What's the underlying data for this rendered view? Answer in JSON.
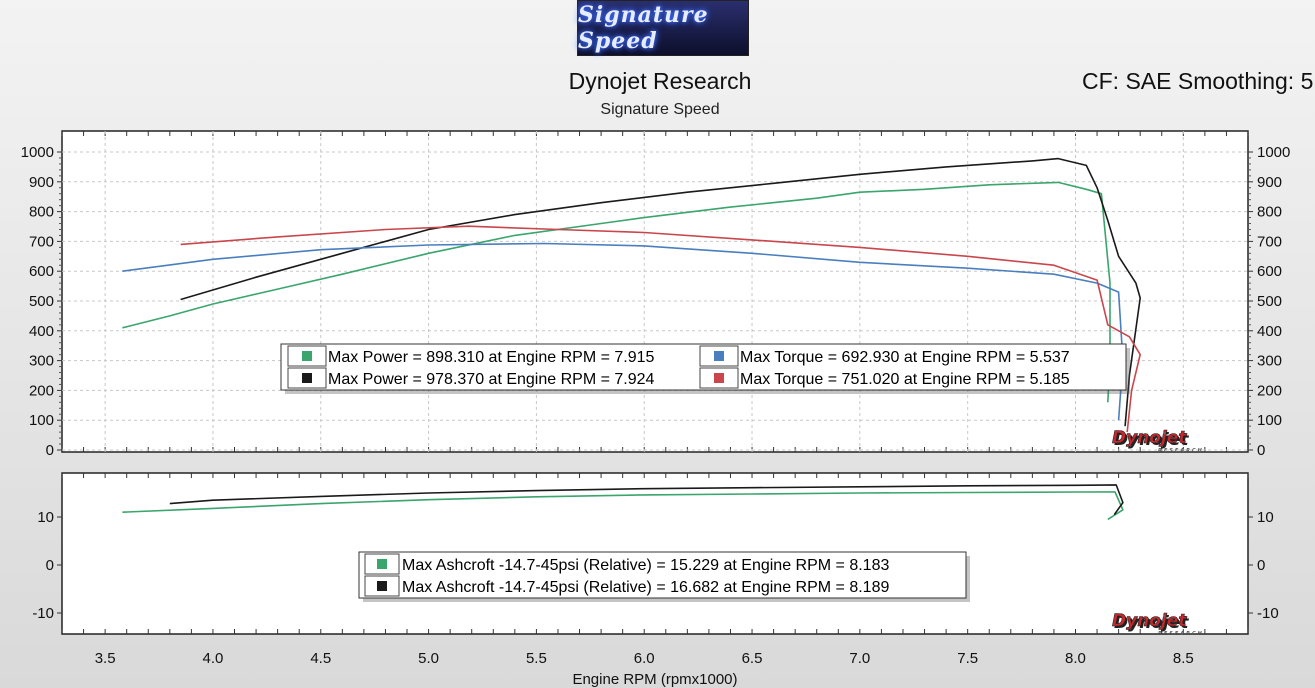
{
  "header": {
    "logo_text": "Signature Speed",
    "title": "Dynojet Research",
    "subtitle": "Signature Speed",
    "cf_text": "CF: SAE Smoothing: 5"
  },
  "brand": {
    "mark": "Dynojet",
    "sub": "RESEARCH"
  },
  "colors": {
    "green": "#3aa56d",
    "black": "#1a1a1a",
    "blue": "#4a7fbf",
    "red": "#c9474c",
    "grid": "#c8c8c8",
    "plot_bg": "#ffffff"
  },
  "chart_data": [
    {
      "type": "line",
      "xlabel": "Engine RPM (rpmx1000)",
      "xlim": [
        3.3,
        8.8
      ],
      "ylim": [
        0,
        1000
      ],
      "y_ticks": [
        0,
        100,
        200,
        300,
        400,
        500,
        600,
        700,
        800,
        900,
        1000
      ],
      "x_ticks": [
        3.5,
        4.0,
        4.5,
        5.0,
        5.5,
        6.0,
        6.5,
        7.0,
        7.5,
        8.0,
        8.5
      ],
      "grid": true,
      "series": [
        {
          "color_key": "green",
          "x": [
            3.58,
            3.8,
            4.0,
            4.3,
            4.6,
            5.0,
            5.4,
            5.8,
            6.0,
            6.4,
            6.8,
            7.0,
            7.3,
            7.6,
            7.92,
            8.05,
            8.12,
            8.16,
            8.16,
            8.15
          ],
          "y": [
            410,
            450,
            490,
            540,
            590,
            660,
            720,
            760,
            780,
            815,
            845,
            865,
            875,
            890,
            898,
            875,
            860,
            560,
            300,
            160
          ]
        },
        {
          "color_key": "black",
          "x": [
            3.85,
            4.2,
            4.6,
            5.0,
            5.4,
            5.8,
            6.2,
            6.6,
            7.0,
            7.4,
            7.8,
            7.92,
            8.05,
            8.1,
            8.15,
            8.2,
            8.28,
            8.3,
            8.25,
            8.23
          ],
          "y": [
            505,
            580,
            660,
            740,
            790,
            830,
            865,
            895,
            925,
            950,
            970,
            978,
            955,
            880,
            770,
            650,
            560,
            510,
            250,
            80
          ]
        },
        {
          "color_key": "blue",
          "x": [
            3.58,
            4.0,
            4.5,
            5.0,
            5.537,
            6.0,
            6.5,
            7.0,
            7.5,
            7.9,
            8.1,
            8.2,
            8.22,
            8.2
          ],
          "y": [
            600,
            640,
            672,
            688,
            693,
            685,
            660,
            630,
            610,
            590,
            560,
            530,
            300,
            100
          ]
        },
        {
          "color_key": "red",
          "x": [
            3.85,
            4.3,
            4.8,
            5.185,
            5.6,
            6.0,
            6.5,
            7.0,
            7.5,
            7.9,
            8.1,
            8.15,
            8.25,
            8.3,
            8.26,
            8.24
          ],
          "y": [
            690,
            715,
            740,
            751,
            740,
            730,
            705,
            680,
            650,
            620,
            570,
            420,
            380,
            320,
            200,
            60
          ]
        }
      ],
      "legend": {
        "placement": "center",
        "entries": [
          {
            "color_key": "green",
            "label": "Max Power = 898.310 at Engine RPM = 7.915"
          },
          {
            "color_key": "blue",
            "label": "Max Torque = 692.930 at Engine RPM = 5.537"
          },
          {
            "color_key": "black",
            "label": "Max Power = 978.370 at Engine RPM = 7.924"
          },
          {
            "color_key": "red",
            "label": "Max Torque = 751.020 at Engine RPM = 5.185"
          }
        ]
      }
    },
    {
      "type": "line",
      "xlim": [
        3.3,
        8.8
      ],
      "ylim": [
        -14,
        19
      ],
      "y_ticks": [
        -10,
        0,
        10
      ],
      "grid": false,
      "series": [
        {
          "color_key": "green",
          "x": [
            3.58,
            4.0,
            4.5,
            5.0,
            5.5,
            6.0,
            6.5,
            7.0,
            7.5,
            8.0,
            8.183,
            8.22,
            8.15
          ],
          "y": [
            11,
            11.8,
            12.8,
            13.6,
            14.2,
            14.6,
            14.8,
            15.0,
            15.1,
            15.2,
            15.229,
            11.5,
            9.5
          ]
        },
        {
          "color_key": "black",
          "x": [
            3.8,
            4.0,
            4.5,
            5.0,
            5.5,
            6.0,
            6.5,
            7.0,
            7.5,
            8.0,
            8.189,
            8.22,
            8.18
          ],
          "y": [
            12.8,
            13.5,
            14.3,
            15.0,
            15.5,
            15.9,
            16.1,
            16.3,
            16.5,
            16.6,
            16.682,
            13,
            10.5
          ]
        }
      ],
      "legend": {
        "placement": "center",
        "entries": [
          {
            "color_key": "green",
            "label": "Max Ashcroft -14.7-45psi (Relative) = 15.229 at Engine RPM = 8.183"
          },
          {
            "color_key": "black",
            "label": "Max Ashcroft -14.7-45psi (Relative) = 16.682 at Engine RPM = 8.189"
          }
        ]
      }
    }
  ]
}
